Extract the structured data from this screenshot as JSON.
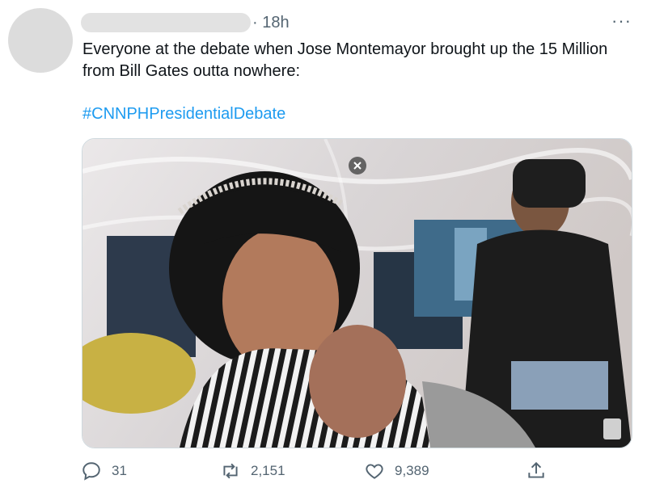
{
  "tweet": {
    "time": "· 18h",
    "more": "···",
    "text": "Everyone at the debate when Jose Montemayor brought up the 15 Million from Bill Gates outta nowhere:",
    "hashtag": "#CNNPHPresidentialDebate"
  },
  "actions": {
    "replies": "31",
    "retweets": "2,151",
    "likes": "9,389"
  },
  "icons": {
    "reply": "reply-icon",
    "retweet": "retweet-icon",
    "like": "heart-icon",
    "share": "share-icon",
    "more": "more-icon"
  },
  "colors": {
    "link": "#1d9bf0",
    "muted": "#536471",
    "text": "#0f1419"
  }
}
